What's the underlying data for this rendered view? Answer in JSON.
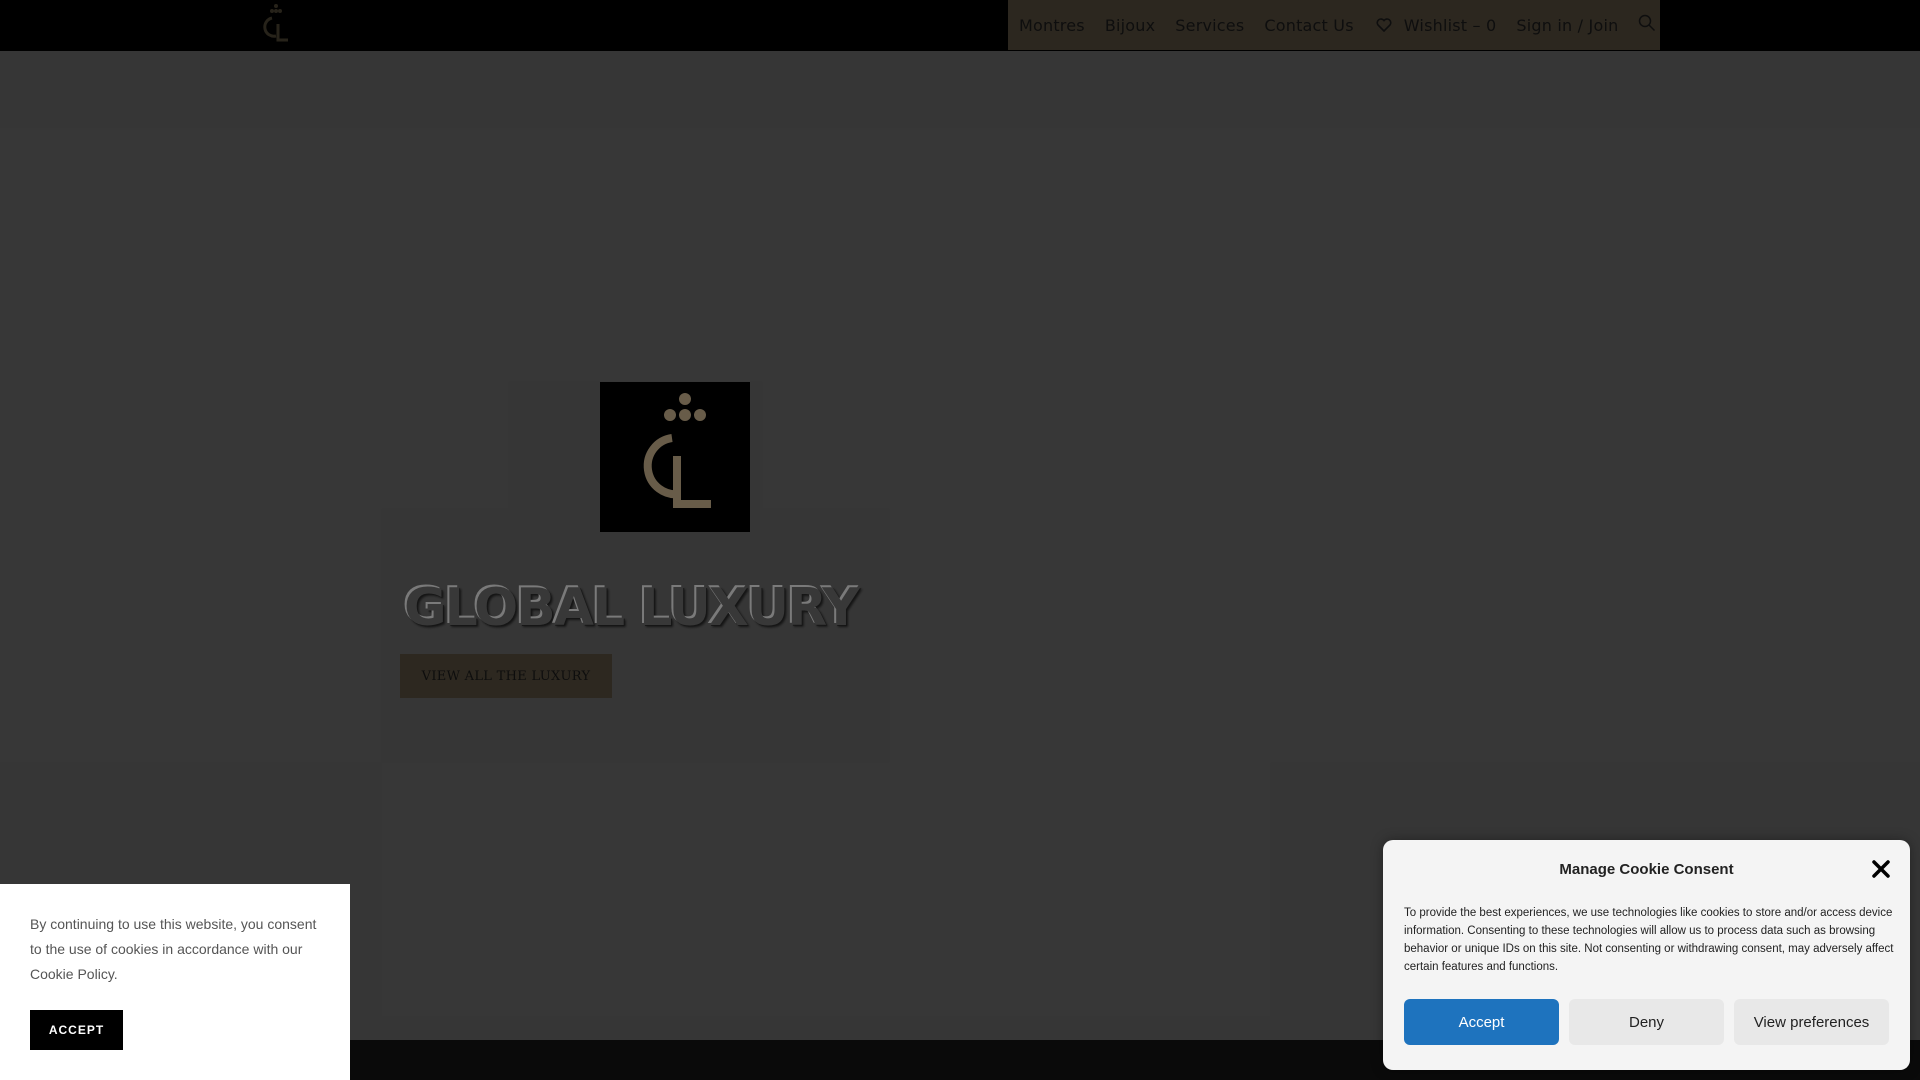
{
  "nav": {
    "items": [
      {
        "label": "Montres"
      },
      {
        "label": "Bijoux"
      },
      {
        "label": "Services"
      },
      {
        "label": "Contact Us"
      }
    ],
    "wishlist_label": "Wishlist – 0",
    "signin_label": "Sign in / Join",
    "search_icon": "search-icon",
    "heart_icon": "heart-icon"
  },
  "hero": {
    "logo_text": "GL",
    "title": "GLOBAL LUXURY",
    "button_label": "VIEW ALL THE LUXURY"
  },
  "cookie_notice": {
    "text_before": "By continuing to use this website, you consent to the use of cookies in accordance with our ",
    "link_label": "Cookie Policy",
    "text_after": ".",
    "accept_label": "ACCEPT"
  },
  "consent_modal": {
    "title": "Manage Cookie Consent",
    "body": "To provide the best experiences, we use technologies like cookies to store and/or access device information. Consenting to these technologies will allow us to process data such as browsing behavior or unique IDs on this site. Not consenting or withdrawing consent, may adversely affect certain features and functions.",
    "accept_label": "Accept",
    "deny_label": "Deny",
    "preferences_label": "View preferences"
  },
  "colors": {
    "brand_gold": "#c4ae8a",
    "accept_blue": "#1e73be"
  }
}
